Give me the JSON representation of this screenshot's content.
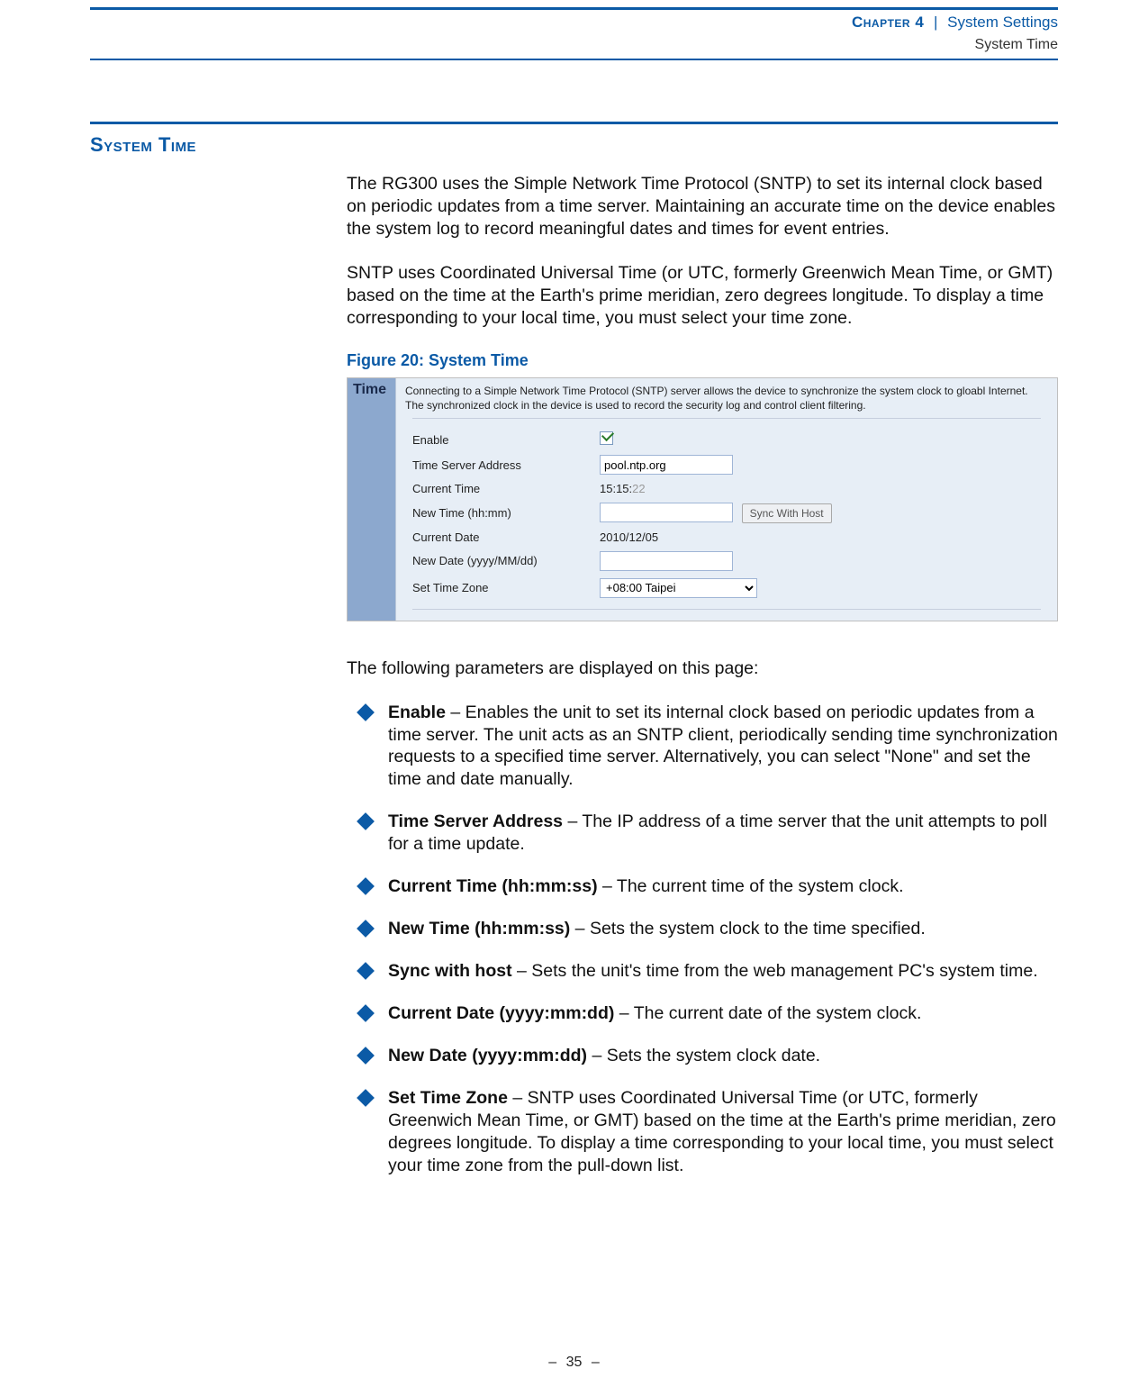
{
  "header": {
    "chapter_prefix": "Chapter 4",
    "pipe": "|",
    "chapter_title": "System Settings",
    "subtitle": "System Time"
  },
  "section_heading": "System Time",
  "intro_para_1": "The RG300 uses the Simple Network Time Protocol (SNTP) to set its internal clock based on periodic updates from a time server. Maintaining an accurate time on the device enables the system log to record meaningful dates and times for event entries.",
  "intro_para_2": "SNTP uses Coordinated Universal Time (or UTC, formerly Greenwich Mean Time, or GMT) based on the time at the Earth's prime meridian, zero degrees longitude. To display a time corresponding to your local time, you must select your time zone.",
  "figure_caption": "Figure 20:  System Time",
  "screenshot": {
    "tab_label": "Time",
    "description": "Connecting to a Simple Network Time Protocol (SNTP) server allows the device to synchronize the system clock to gloabl Internet. The synchronized clock in the device is used to record the security log and control client filtering.",
    "rows": {
      "enable_label": "Enable",
      "server_label": "Time Server Address",
      "server_value": "pool.ntp.org",
      "curtime_label": "Current Time",
      "curtime_value_main": "15:15:",
      "curtime_value_faded": "22",
      "newtime_label": "New Time (hh:mm)",
      "sync_button": "Sync With Host",
      "curdate_label": "Current Date",
      "curdate_value": "2010/12/05",
      "newdate_label": "New Date (yyyy/MM/dd)",
      "tz_label": "Set Time Zone",
      "tz_value": "+08:00 Taipei"
    }
  },
  "params_intro": "The following parameters are displayed on this page:",
  "bullets": [
    {
      "term": "Enable",
      "desc": " – Enables the unit to set its internal clock based on periodic updates from a time server. The unit acts as an SNTP client, periodically sending time synchronization requests to a specified time server. Alternatively, you can select \"None\" and set the time and date manually."
    },
    {
      "term": "Time Server Address",
      "desc": " – The IP address of a time server that the unit attempts to poll for a time update."
    },
    {
      "term": "Current Time (hh:mm:ss)",
      "desc": " – The current time of the system clock."
    },
    {
      "term": "New Time (hh:mm:ss)",
      "desc": " – Sets the system clock to the time specified."
    },
    {
      "term": "Sync with host",
      "desc": " – Sets the unit's time from the web management PC's system time."
    },
    {
      "term": "Current Date (yyyy:mm:dd)",
      "desc": " – The current date of the system clock."
    },
    {
      "term": "New Date (yyyy:mm:dd)",
      "desc": " – Sets the system clock date."
    },
    {
      "term": "Set Time Zone",
      "desc": " – SNTP uses Coordinated Universal Time (or UTC, formerly Greenwich Mean Time, or GMT) based on the time at the Earth's prime meridian, zero degrees longitude. To display a time corresponding to your local time, you must select your time zone from the pull-down list."
    }
  ],
  "footer": {
    "dash": "–",
    "page": "35"
  }
}
